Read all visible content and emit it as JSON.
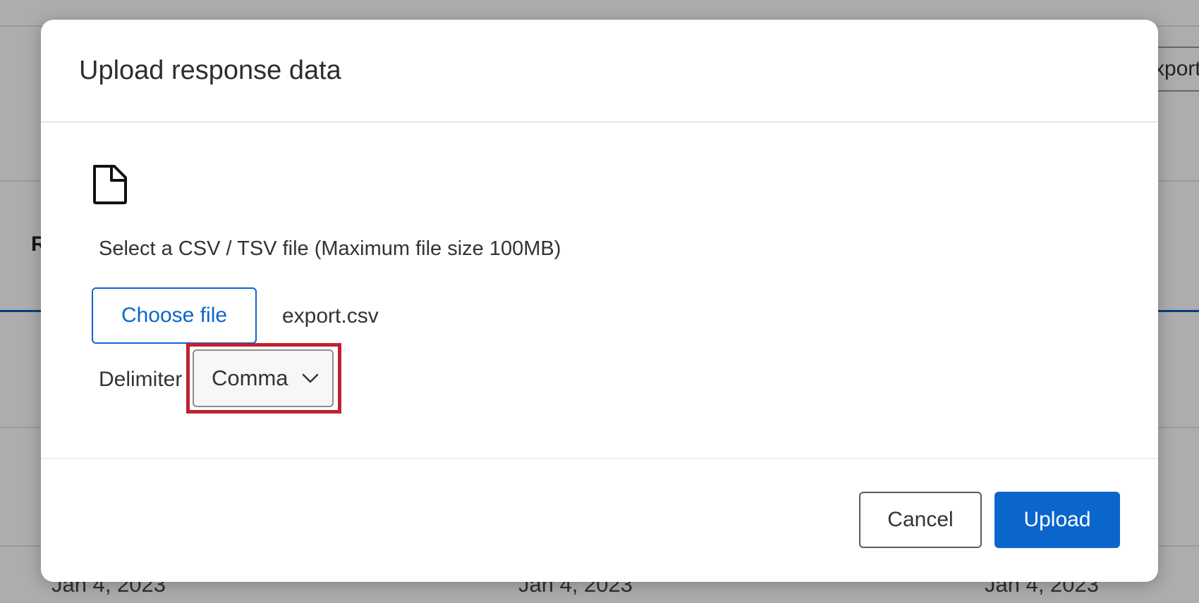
{
  "background": {
    "export_button_label": "Export &",
    "column_letter": "R",
    "dates": [
      "Jan 4, 2023",
      "Jan 4, 2023",
      "Jan 4, 2023"
    ]
  },
  "modal": {
    "title": "Upload response data",
    "file_icon": "file-icon",
    "instructions": "Select a CSV / TSV file (Maximum file size 100MB)",
    "choose_file_label": "Choose file",
    "file_name": "export.csv",
    "delimiter_label": "Delimiter",
    "delimiter_value": "Comma",
    "cancel_label": "Cancel",
    "upload_label": "Upload"
  },
  "colors": {
    "primary": "#0b66cc",
    "highlight": "#c0222f"
  }
}
